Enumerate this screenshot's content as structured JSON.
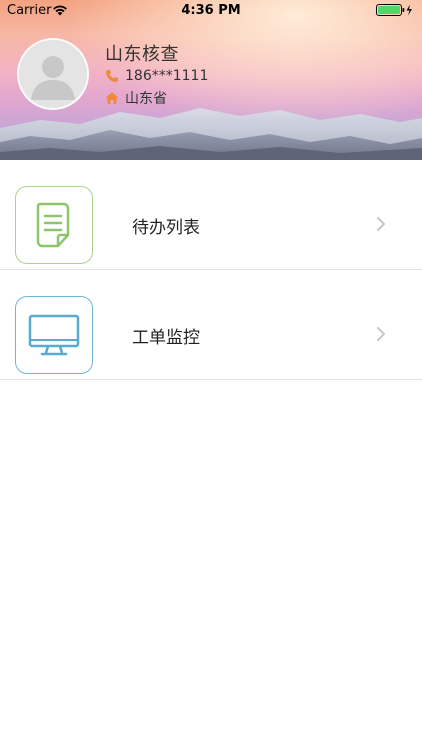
{
  "status_bar": {
    "carrier": "Carrier",
    "time": "4:36 PM",
    "wifi_icon": "wifi-icon",
    "battery_icon": "battery-charging-icon",
    "battery_color": "#4cd964"
  },
  "profile": {
    "name": "山东核查",
    "phone": "186***1111",
    "address": "山东省",
    "phone_icon": "phone-icon",
    "home_icon": "home-icon",
    "icon_color": "#f08a3c"
  },
  "menu": {
    "items": [
      {
        "label": "待办列表",
        "icon": "document-icon",
        "icon_color": "#8cc56a"
      },
      {
        "label": "工单监控",
        "icon": "monitor-icon",
        "icon_color": "#5aa9cf"
      }
    ]
  }
}
